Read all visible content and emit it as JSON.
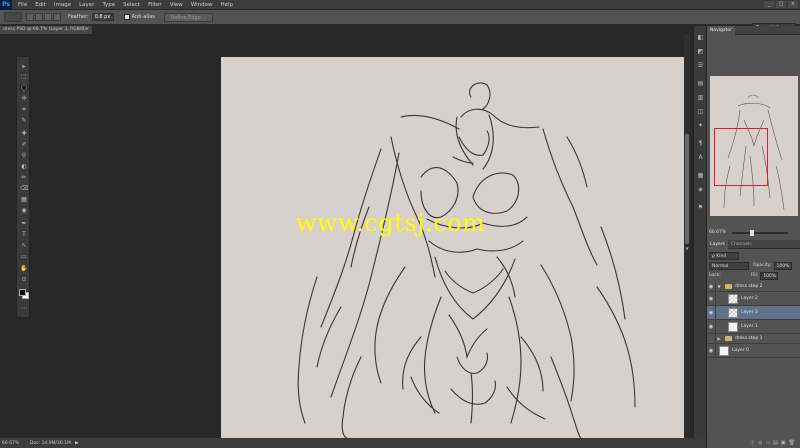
{
  "app": {
    "logo": "Ps"
  },
  "menu": [
    "File",
    "Edit",
    "Image",
    "Layer",
    "Type",
    "Select",
    "Filter",
    "View",
    "Window",
    "Help"
  ],
  "window_controls": [
    "_",
    "□",
    "×"
  ],
  "options": {
    "feather_label": "Feather:",
    "feather_value": "0.8 px",
    "antialias_label": "Anti-alias",
    "refine_edge": "Refine Edge..."
  },
  "workspace": "Essentials",
  "document": {
    "tab_title": "dress.PSD @ 66.7% (Layer 3, RGB/8)",
    "close": "×",
    "watermark": "www.cgtsj.com"
  },
  "status": {
    "zoom": "66.67%",
    "doc": "Doc: 14.9M/30.1M",
    "arrow": "▶"
  },
  "tools": [
    "▸",
    "⬚",
    "◯",
    "✣",
    "⌗",
    "✎",
    "✚",
    "✐",
    "⚲",
    "◐",
    "✏",
    "⌫",
    "▦",
    "◉",
    "✒",
    "T",
    "↖",
    "▭",
    "✋",
    "⊙",
    "⋯"
  ],
  "dock_icons": [
    "◧",
    "◩",
    "☰",
    "▤",
    "▥",
    "◫",
    "✦",
    "¶",
    "A",
    "▦",
    "◈",
    "⚑"
  ],
  "navigator": {
    "tab": "Navigator",
    "zoom": "66.67%"
  },
  "layers_panel": {
    "tabs": [
      "Layers",
      "Channels"
    ],
    "kind": "ρ Kind",
    "blend_mode": "Normal",
    "opacity_label": "Opacity:",
    "opacity_value": "100%",
    "lock_label": "Lock:",
    "fill_label": "Fill:",
    "fill_value": "100%",
    "layers": [
      {
        "name": "dress  step 2",
        "type": "group",
        "expanded": true,
        "selected": false
      },
      {
        "name": "Layer 2",
        "type": "layer",
        "selected": false
      },
      {
        "name": "Layer 3",
        "type": "layer",
        "selected": true
      },
      {
        "name": "Layer 1",
        "type": "layer",
        "selected": false
      },
      {
        "name": "dress  step 1",
        "type": "group",
        "expanded": false,
        "selected": false
      },
      {
        "name": "Layer 0",
        "type": "layer",
        "selected": false
      }
    ],
    "footer_icons": [
      "ⓕ",
      "◎",
      "▭",
      "▤",
      "▣",
      "🗑"
    ]
  }
}
